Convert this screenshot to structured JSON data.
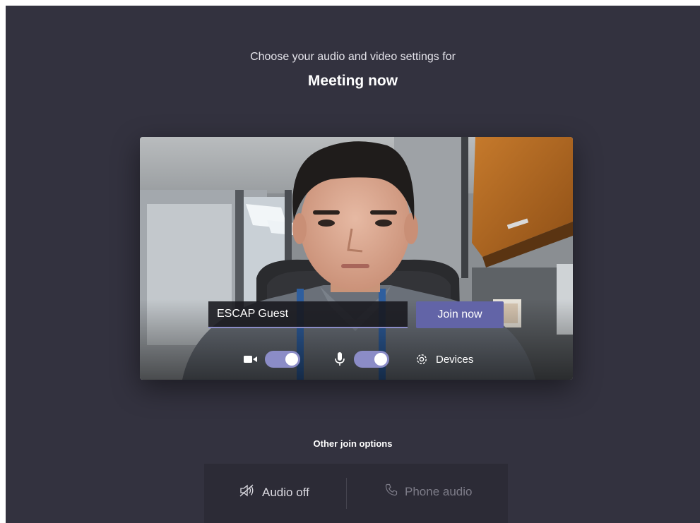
{
  "header": {
    "subtitle": "Choose your audio and video settings for",
    "meeting_title": "Meeting now"
  },
  "preview": {
    "name_input_value": "ESCAP Guest",
    "join_label": "Join now",
    "camera_icon": "video-camera-icon",
    "camera_toggle_on": true,
    "mic_icon": "microphone-icon",
    "mic_toggle_on": true,
    "devices_icon": "gear-icon",
    "devices_label": "Devices"
  },
  "other_options": {
    "heading": "Other join options",
    "audio_off_label": "Audio off",
    "audio_off_icon": "speaker-muted-icon",
    "phone_audio_label": "Phone audio",
    "phone_audio_icon": "phone-icon"
  },
  "colors": {
    "background": "#33323f",
    "accent": "#6264a7",
    "toggle_on": "#8b8cc7",
    "options_bar": "#2c2b36"
  }
}
